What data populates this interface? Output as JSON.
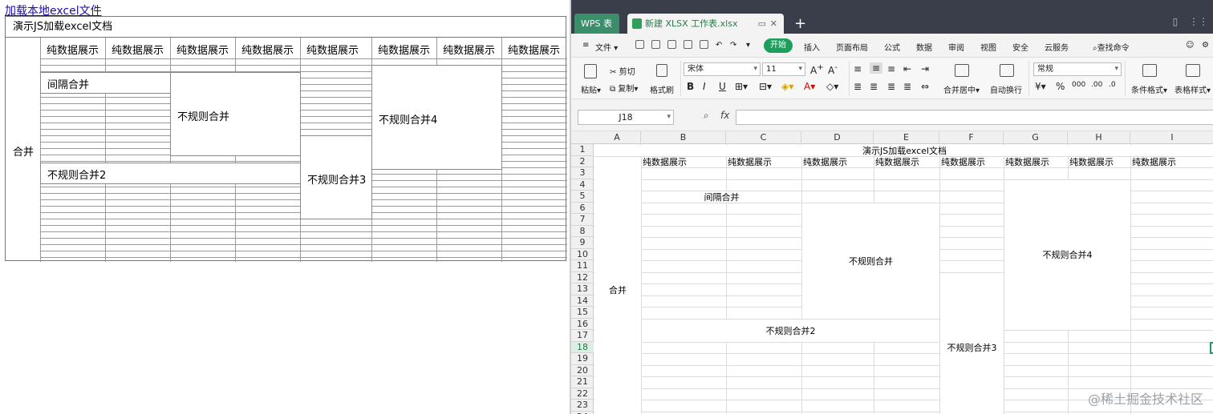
{
  "left": {
    "load_link": "加载本地excel文件",
    "title": "演示JS加载excel文档",
    "header_cells": [
      "纯数据展示",
      "纯数据展示",
      "纯数据展示",
      "纯数据展示",
      "纯数据展示",
      "纯数据展示",
      "纯数据展示",
      "纯数据展示"
    ],
    "merge_label": "合并",
    "interval_merge": "间隔合并",
    "irregular_merge": "不规则合并",
    "irregular_merge_2": "不规则合并2",
    "irregular_merge_3": "不规则合并3",
    "irregular_merge_4": "不规则合并4"
  },
  "wps": {
    "home_tab": "WPS 表格",
    "doc_tab": "新建 XLSX 工作表.xlsx",
    "menu": {
      "file": "文件",
      "start": "开始",
      "insert": "插入",
      "page_layout": "页面布局",
      "formula": "公式",
      "data": "数据",
      "review": "审阅",
      "view": "视图",
      "security": "安全",
      "cloud": "云服务",
      "search": "查找命令"
    },
    "ribbon": {
      "paste": "粘贴",
      "cut": "剪切",
      "copy": "复制",
      "format_painter": "格式刷",
      "font_name": "宋体",
      "font_size": "11",
      "merge_center": "合并居中",
      "wrap_text": "自动换行",
      "number_format": "常规",
      "cond_format": "条件格式",
      "table_style": "表格样式"
    },
    "name_box": "J18",
    "fx": "fx",
    "columns": [
      "A",
      "B",
      "C",
      "D",
      "E",
      "F",
      "G",
      "H",
      "I"
    ],
    "rows": [
      "1",
      "2",
      "3",
      "4",
      "5",
      "6",
      "7",
      "8",
      "9",
      "10",
      "11",
      "12",
      "13",
      "14",
      "15",
      "16",
      "17",
      "18",
      "19",
      "20",
      "21",
      "22",
      "23",
      "24"
    ],
    "selected_row": "18",
    "cells": {
      "title": "演示JS加载excel文档",
      "header": [
        "纯数据展示",
        "纯数据展示",
        "纯数据展示",
        "纯数据展示",
        "纯数据展示",
        "纯数据展示",
        "纯数据展示",
        "纯数据展示"
      ],
      "merge": "合并",
      "interval_merge": "间隔合并",
      "irregular_merge": "不规则合并",
      "irregular_merge_2": "不规则合并2",
      "irregular_merge_3": "不规则合并3",
      "irregular_merge_4": "不规则合并4"
    },
    "watermark": "@稀土掘金技术社区"
  }
}
